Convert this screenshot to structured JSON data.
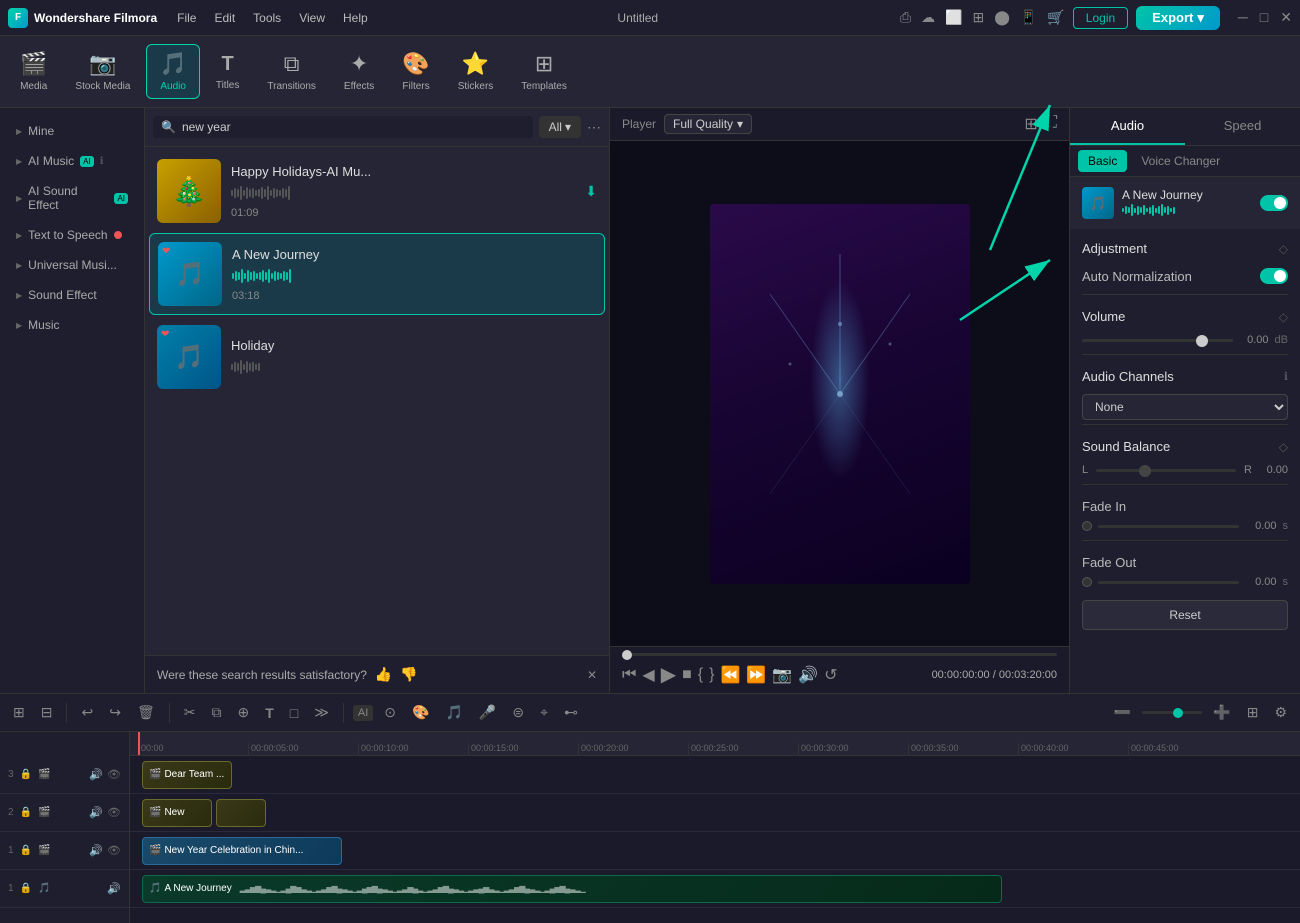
{
  "app": {
    "name": "Wondershare Filmora",
    "project": "Untitled",
    "logo": "F"
  },
  "titlebar": {
    "menus": [
      "File",
      "Edit",
      "Tools",
      "View",
      "Help"
    ],
    "login_label": "Login",
    "export_label": "Export",
    "export_arrow": "▾"
  },
  "toolbar": {
    "items": [
      {
        "id": "media",
        "icon": "🎬",
        "label": "Media"
      },
      {
        "id": "stock",
        "icon": "📷",
        "label": "Stock Media"
      },
      {
        "id": "audio",
        "icon": "🎵",
        "label": "Audio"
      },
      {
        "id": "titles",
        "icon": "T",
        "label": "Titles"
      },
      {
        "id": "transitions",
        "icon": "⧉",
        "label": "Transitions"
      },
      {
        "id": "effects",
        "icon": "✦",
        "label": "Effects"
      },
      {
        "id": "filters",
        "icon": "🎨",
        "label": "Filters"
      },
      {
        "id": "stickers",
        "icon": "⭐",
        "label": "Stickers"
      },
      {
        "id": "templates",
        "icon": "⊞",
        "label": "Templates"
      }
    ],
    "active": "audio"
  },
  "sidebar": {
    "items": [
      {
        "id": "mine",
        "label": "Mine",
        "arrow": "▶"
      },
      {
        "id": "ai-music",
        "label": "AI Music",
        "badge": "AI",
        "info": "ℹ",
        "arrow": "▶"
      },
      {
        "id": "ai-sound",
        "label": "AI Sound Effect",
        "badge": "AI",
        "arrow": "▶"
      },
      {
        "id": "tts",
        "label": "Text to Speech",
        "dot": true,
        "arrow": "▶"
      },
      {
        "id": "universal",
        "label": "Universal Musi...",
        "arrow": "▶"
      },
      {
        "id": "sound-effect",
        "label": "Sound Effect",
        "arrow": "▶"
      },
      {
        "id": "music",
        "label": "Music",
        "arrow": "▶"
      }
    ]
  },
  "audio_panel": {
    "search_placeholder": "new year",
    "filter_label": "All",
    "items": [
      {
        "id": "item1",
        "name": "Happy Holidays-AI Mu...",
        "duration": "01:09",
        "has_thumb": true,
        "thumb_color": "#c8a000",
        "active": false
      },
      {
        "id": "item2",
        "name": "A New Journey",
        "duration": "03:18",
        "has_thumb": false,
        "active": true,
        "heart": true
      },
      {
        "id": "item3",
        "name": "Holiday",
        "duration": "",
        "has_thumb": false,
        "active": false,
        "heart": true
      }
    ],
    "feedback": {
      "text": "Were these search results satisfactory?",
      "thumb_up": "👍",
      "thumb_down": "👎"
    }
  },
  "player": {
    "label": "Player",
    "quality": "Full Quality",
    "current_time": "00:00:00:00",
    "total_time": "00:03:20:00",
    "separator": "/"
  },
  "right_panel": {
    "tabs": [
      "Audio",
      "Speed"
    ],
    "active_tab": "Audio",
    "sub_tabs": [
      "Basic",
      "Voice Changer"
    ],
    "active_sub": "Basic",
    "current_track_name": "A New Journey",
    "adjustment_label": "Adjustment",
    "auto_norm_label": "Auto Normalization",
    "auto_norm_enabled": true,
    "volume_label": "Volume",
    "volume_value": "0.00",
    "volume_unit": "dB",
    "audio_channels_label": "Audio Channels",
    "audio_channels_info": "ℹ",
    "audio_channels_value": "None",
    "sound_balance_label": "Sound Balance",
    "sound_balance_L": "L",
    "sound_balance_R": "R",
    "sound_balance_value": "0.00",
    "fade_in_label": "Fade In",
    "fade_in_value": "0.00",
    "fade_in_unit": "s",
    "fade_out_label": "Fade Out",
    "fade_out_value": "0.00",
    "fade_out_unit": "s",
    "reset_label": "Reset"
  },
  "timeline": {
    "toolbar_buttons": [
      "⊞",
      "⊟",
      "undo",
      "redo",
      "🗑",
      "✂",
      "copy",
      "paste",
      "T",
      "□",
      "○",
      "≫"
    ],
    "tracks": [
      {
        "num": "3",
        "label": "Dear Team ...",
        "type": "video2",
        "icon": "🎬",
        "color": "#3a6a9a"
      },
      {
        "num": "2",
        "label": "New",
        "type": "video2",
        "icon": "🎬"
      },
      {
        "num": "1",
        "label": "New Year Celebration in Chin...",
        "type": "video",
        "icon": "🎬"
      },
      {
        "num": "1",
        "label": "A New Journey",
        "type": "audio-clip",
        "icon": "🎵"
      }
    ],
    "ruler_marks": [
      "00:00",
      "00:00:05:00",
      "00:00:10:00",
      "00:00:15:00",
      "00:00:20:00",
      "00:00:25:00",
      "00:00:30:00",
      "00:00:35:00",
      "00:00:40:00",
      "00:00:45:00"
    ]
  }
}
